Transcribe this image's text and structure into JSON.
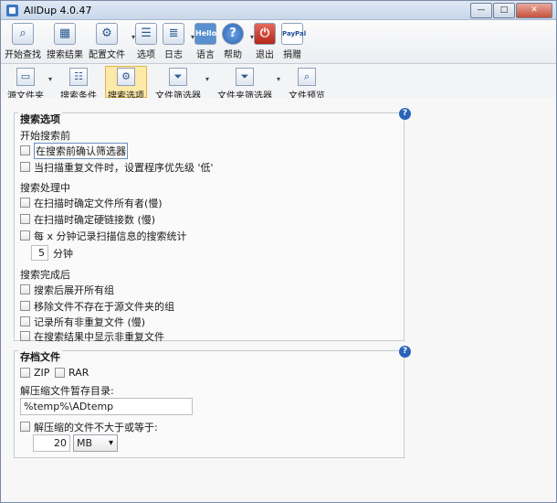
{
  "window": {
    "title": "AllDup 4.0.47"
  },
  "toolbar": [
    {
      "label": "开始查找",
      "icon": "search-icon"
    },
    {
      "label": "搜索结果",
      "icon": "results-icon"
    },
    {
      "label": "配置文件",
      "icon": "profile-icon"
    },
    {
      "label": "选项",
      "icon": "options-icon"
    },
    {
      "label": "日志",
      "icon": "log-icon"
    },
    {
      "label": "语言",
      "icon": "language-icon",
      "badge": "Hello"
    },
    {
      "label": "帮助",
      "icon": "help-icon"
    },
    {
      "label": "退出",
      "icon": "exit-icon"
    },
    {
      "label": "捐赠",
      "icon": "donate-icon",
      "badge": "PayPal"
    }
  ],
  "subtoolbar": [
    {
      "label": "源文件夹"
    },
    {
      "label": "搜索条件"
    },
    {
      "label": "搜索选项"
    },
    {
      "label": "文件筛选器"
    },
    {
      "label": "文件夹筛选器"
    },
    {
      "label": "文件预览"
    }
  ],
  "search_options": {
    "title": "搜索选项",
    "before": {
      "header": "开始搜索前",
      "items": [
        "在搜索前确认筛选器",
        "当扫描重复文件时，设置程序优先级 '低'"
      ]
    },
    "during": {
      "header": "搜索处理中",
      "items": [
        "在扫描时确定文件所有者(慢)",
        "在扫描时确定硬链接数 (慢)",
        "每 x 分钟记录扫描信息的搜索统计"
      ],
      "minutes_value": "5",
      "minutes_label": "分钟"
    },
    "after": {
      "header": "搜索完成后",
      "items": [
        "搜索后展开所有组",
        "移除文件不存在于源文件夹的组",
        "记录所有非重复文件 (慢)",
        "在搜索结果中显示非重复文件"
      ]
    }
  },
  "archive": {
    "title": "存档文件",
    "zip_label": "ZIP",
    "rar_label": "RAR",
    "temp_dir_label": "解压缩文件暂存目录:",
    "temp_dir_value": "%temp%\\ADtemp",
    "size_limit_label": "解压缩的文件不大于或等于:",
    "size_value": "20",
    "size_unit": "MB"
  },
  "help_glyph": "?"
}
